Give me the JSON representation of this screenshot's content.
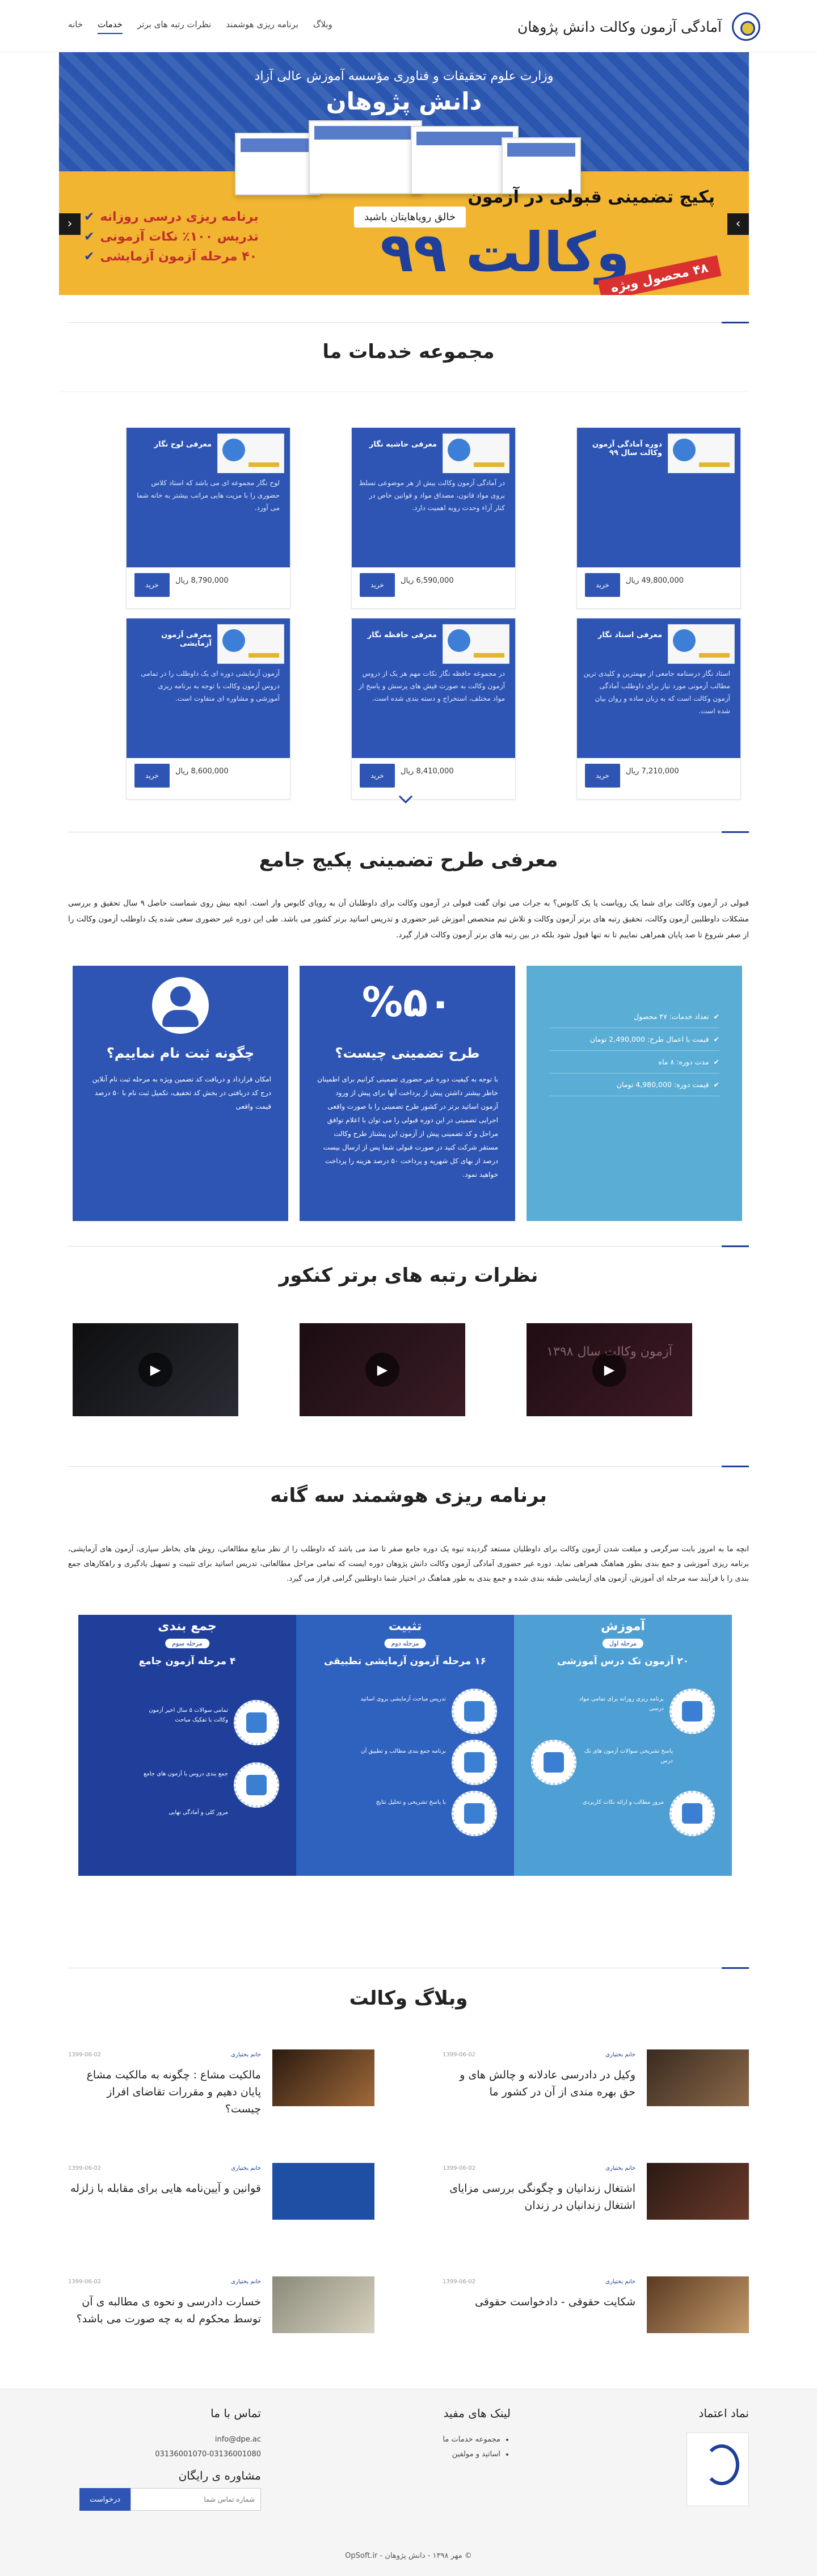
{
  "header": {
    "site_title": "آمادگی آزمون وکالت دانش پژوهان",
    "nav": [
      "خانه",
      "خدمات",
      "نظرات رتبه های برتر",
      "برنامه ریزی هوشمند",
      "وبلاگ"
    ]
  },
  "hero": {
    "ministry": "وزارت علوم تحقیقات و فناوری  مؤسسه آموزش عالی آزاد",
    "brand": "دانش پژوهان",
    "slogan": "خالق رویاهایتان باشید",
    "package": "پکیج تضمینی قبولی در آزمون",
    "big_title": "وکالت ۹۹",
    "badge": "۴۸ محصول ویژه",
    "bullets": [
      "برنامه ریزی درسی روزانه",
      "تدریس ۱۰۰٪ نکات آزمونی",
      "۴۰ مرحله آزمون آزمایشی"
    ]
  },
  "services": {
    "title": "مجموعه خدمات ما",
    "buy_label": "خرید",
    "cards": [
      {
        "title": "دوره آمادگی آزمون وکالت سال ۹۹",
        "desc": "",
        "price": "49,800,000 ریال"
      },
      {
        "title": "معرفی حاشیه نگار",
        "desc": "در آمادگی آزمون وکالت بیش از هر موضوعی تسلط بروی مواد قانون، مصداق مواد و قوانین خاص در کنار آراء وحدت رویه اهمیت دارد.",
        "price": "6,590,000 ریال"
      },
      {
        "title": "معرفی لوح نگار",
        "desc": "لوح نگار مجموعه ای می باشد که استاد کلاس حضوری را با مزیت هایی مراتب بیشتر به خانه شما می آورد.",
        "price": "8,790,000 ریال"
      },
      {
        "title": "معرفی استاد نگار",
        "desc": "استاد نگار درسنامه جامعی از مهمترین و کلیدی ترین مطالب آزمونی مورد نیاز برای داوطلب آمادگی آزمون وکالت است که به زبان ساده و روان بیان شده است.",
        "price": "7,210,000 ریال"
      },
      {
        "title": "معرفی حافظه نگار",
        "desc": "در مجموعه حافظه نگار نکات مهم هر یک از دروس آزمون وکالت به صورت فیش های پرسش و پاسخ از مواد مختلف، استخراج و دسته بندی شده است.",
        "price": "8,410,000 ریال"
      },
      {
        "title": "معرفی آزمون آزمایشی",
        "desc": "آزمون آزمایشی دوره ای یک داوطلب را در تمامی دروس آزمون وکالت با توجه به برنامه ریزی آموزشی و مشاوره ای متفاوت است.",
        "price": "8,600,000 ریال"
      }
    ]
  },
  "intro": {
    "title": "معرفی طرح تضمینی پکیج جامع",
    "text": "قبولی در آزمون وکالت برای شما یک رویاست یا یک کابوس؟ به جرات می توان گفت قبولی در آزمون وکالت برای داوطلبان آن به رویای کابوس وار است. انچه بیش روی شماست حاصل ۹ سال تحقیق و بررسی مشکلات داوطلبین آزمون وکالت، تحقیق رتبه های برتر آزمون وکالت و تلاش تیم متخصص آموزش غیر حضوری و تدریس اساتید برتر کشور می باشد. طی این دوره غیر حضوری سعی شده یک داوطلب آزمون وکالت را از صفر شروع تا صد پایان همراهی نماییم تا نه تنها قبول شود بلکه در بین رتبه های برتر آزمون وکالت قرار گیرد.",
    "box_register": {
      "title": "چگونه ثبت نام نماییم؟",
      "text": "امکان قرارداد و دریافت کد تضمین ویژه به مرحله ثبت نام آنلاین درج کد دریافتی در بخش کد تخفیف، تکمیل ثبت نام با ۵۰ درصد قیمت واقعی"
    },
    "box_guarantee": {
      "percent": "%۵۰",
      "title": "طرح تضمینی چیست؟",
      "text": "با توجه به کیفیت دوره غیر حضوری تضمینی کرانیم برای اطمینان خاطر بیشتر داشتن پیش از پرداخت آنها برای پیش از ورود آزمون اساتید برتر در کشور طرح تضمینی را با صورت واقعی اجرایی تضمینی در این دوره قبولی را می توان با اعلام توافق مراحل و کد تضمینی پیش از آزمون این پیشتاز طرح وکالت مستقر شرکت کنید در صورت قبولی شما پس از ارسال بیست درصد از بهای کل شهریه و پرداخت ۵۰ درصد هزینه را پرداخت خواهید نمود."
    },
    "box_features": [
      "تعداد خدمات: ۴۷ محصول",
      "قیمت با اعمال طرح: 2,490,000 تومان",
      "مدت دوره: ۸ ماه",
      "قیمت دوره: 4,980,000 تومان"
    ]
  },
  "reviews": {
    "title": "نظرات رتبه های برتر کنکور",
    "videos": [
      {
        "caption": "آزمون وکالت سال ۱۳۹۸"
      },
      {
        "caption": ""
      },
      {
        "caption": ""
      }
    ]
  },
  "plan": {
    "title": "برنامه ریزی هوشمند سه گانه",
    "text": "انچه ما به امروز بابت سرگرمی و مبلغت شدن آزمون وکالت برای داوطلبان مستعد گردیده تبوه یک دوره جامع صفر تا صد می باشد که داوطلب را از نظر منابع مطالعاتی، روش های بخاطر سپاری، آزمون های آزمایشی، برنامه ریزی آموزشی و جمع بندی بطور هماهنگ همراهی نماید. دوره غیر حضوری آمادگی آزمون وکالت دانش پژوهان دوره ایست که تمامی مراحل مطالعاتی، تدریس اساتید برای تثبیت و تسهیل یادگیری و راهکارهای جمع بندی را با فرآیند سه مرحله ای آموزش، آزمون های آزمایشی طبقه بندی شده و جمع بندی به طور هماهنگ در اختیار شما داوطلبین گرامی قرار می گیرد.",
    "columns": [
      {
        "head": "آموزش",
        "pill": "مرحله اول",
        "sub": "۲۰ آزمون تک درس آموزشی",
        "items": [
          "برنامه ریزی روزانه برای تمامی مواد درسی",
          "پاسخ تشریحی سوالات آزمون های تک درس",
          "مرور مطالب و ارائه نکات کاربردی"
        ]
      },
      {
        "head": "تثبیت",
        "pill": "مرحله دوم",
        "sub": "۱۶ مرحله آزمون آزمایشی تطبیقی",
        "items": [
          "تدریس مباحث آزمایشی بروی اساتید",
          "برنامه جمع بندی مطالب و تطبیق آن",
          "با پاسخ تشریحی و تحلیل نتایج"
        ]
      },
      {
        "head": "جمع بندی",
        "pill": "مرحله سوم",
        "sub": "۴ مرحله آزمون جامع",
        "items": [
          "تمامی سوالات ۵ سال اخیر آزمون وکالت با تفکیک مباحث",
          "جمع بندی دروس با آزمون های جامع",
          "مرور کلی و آمادگی نهایی"
        ]
      }
    ]
  },
  "blog": {
    "title": "وبلاگ وکالت",
    "posts": [
      {
        "title": "وکیل در دادرسی عادلانه و چالش های و حق بهره مندی از آن در کشور ما",
        "author": "خانم بختیاری",
        "date": "1399-06-02"
      },
      {
        "title": "مالکیت مشاع : چگونه به مالکیت مشاع پایان دهیم و مقررات تقاضای افراز چیست؟",
        "author": "خانم بختیاری",
        "date": "1399-06-02"
      },
      {
        "title": "اشتغال زندانیان و چگونگی بررسی مزایای اشتغال زندانیان در زندان",
        "author": "خانم بختیاری",
        "date": "1399-06-02"
      },
      {
        "title": "قوانین و آیین‌نامه هایی برای مقابله با زلزله",
        "author": "خانم بختیاری",
        "date": "1399-06-02"
      },
      {
        "title": "شکایت حقوقی - دادخواست حقوقی",
        "author": "خانم بختیاری",
        "date": "1399-06-02"
      },
      {
        "title": "خسارت دادرسی و نحوه ی مطالبه ی آن توسط محکوم له به چه صورت می باشد؟",
        "author": "خانم بختیاری",
        "date": "1399-06-02"
      }
    ]
  },
  "footer": {
    "trust_title": "نماد اعتماد",
    "links_title": "لینک های مفید",
    "links": [
      "مجموعه خدمات ما",
      "اساتید و مولفین"
    ],
    "contact_title": "تماس با ما",
    "email": "info@dpe.ac",
    "phones": "03136001070-03136001080",
    "consult_title": "مشاوره ی رایگان",
    "input_placeholder": "شماره تماس شما",
    "submit_label": "درخواست",
    "copyright": "© مهر ۱۳۹۸ - دانش پژوهان - OpSoft.ir"
  },
  "colors": {
    "primary": "#2e55b4",
    "accent": "#f1b532",
    "light": "#5aaed5",
    "red": "#d8312f"
  }
}
